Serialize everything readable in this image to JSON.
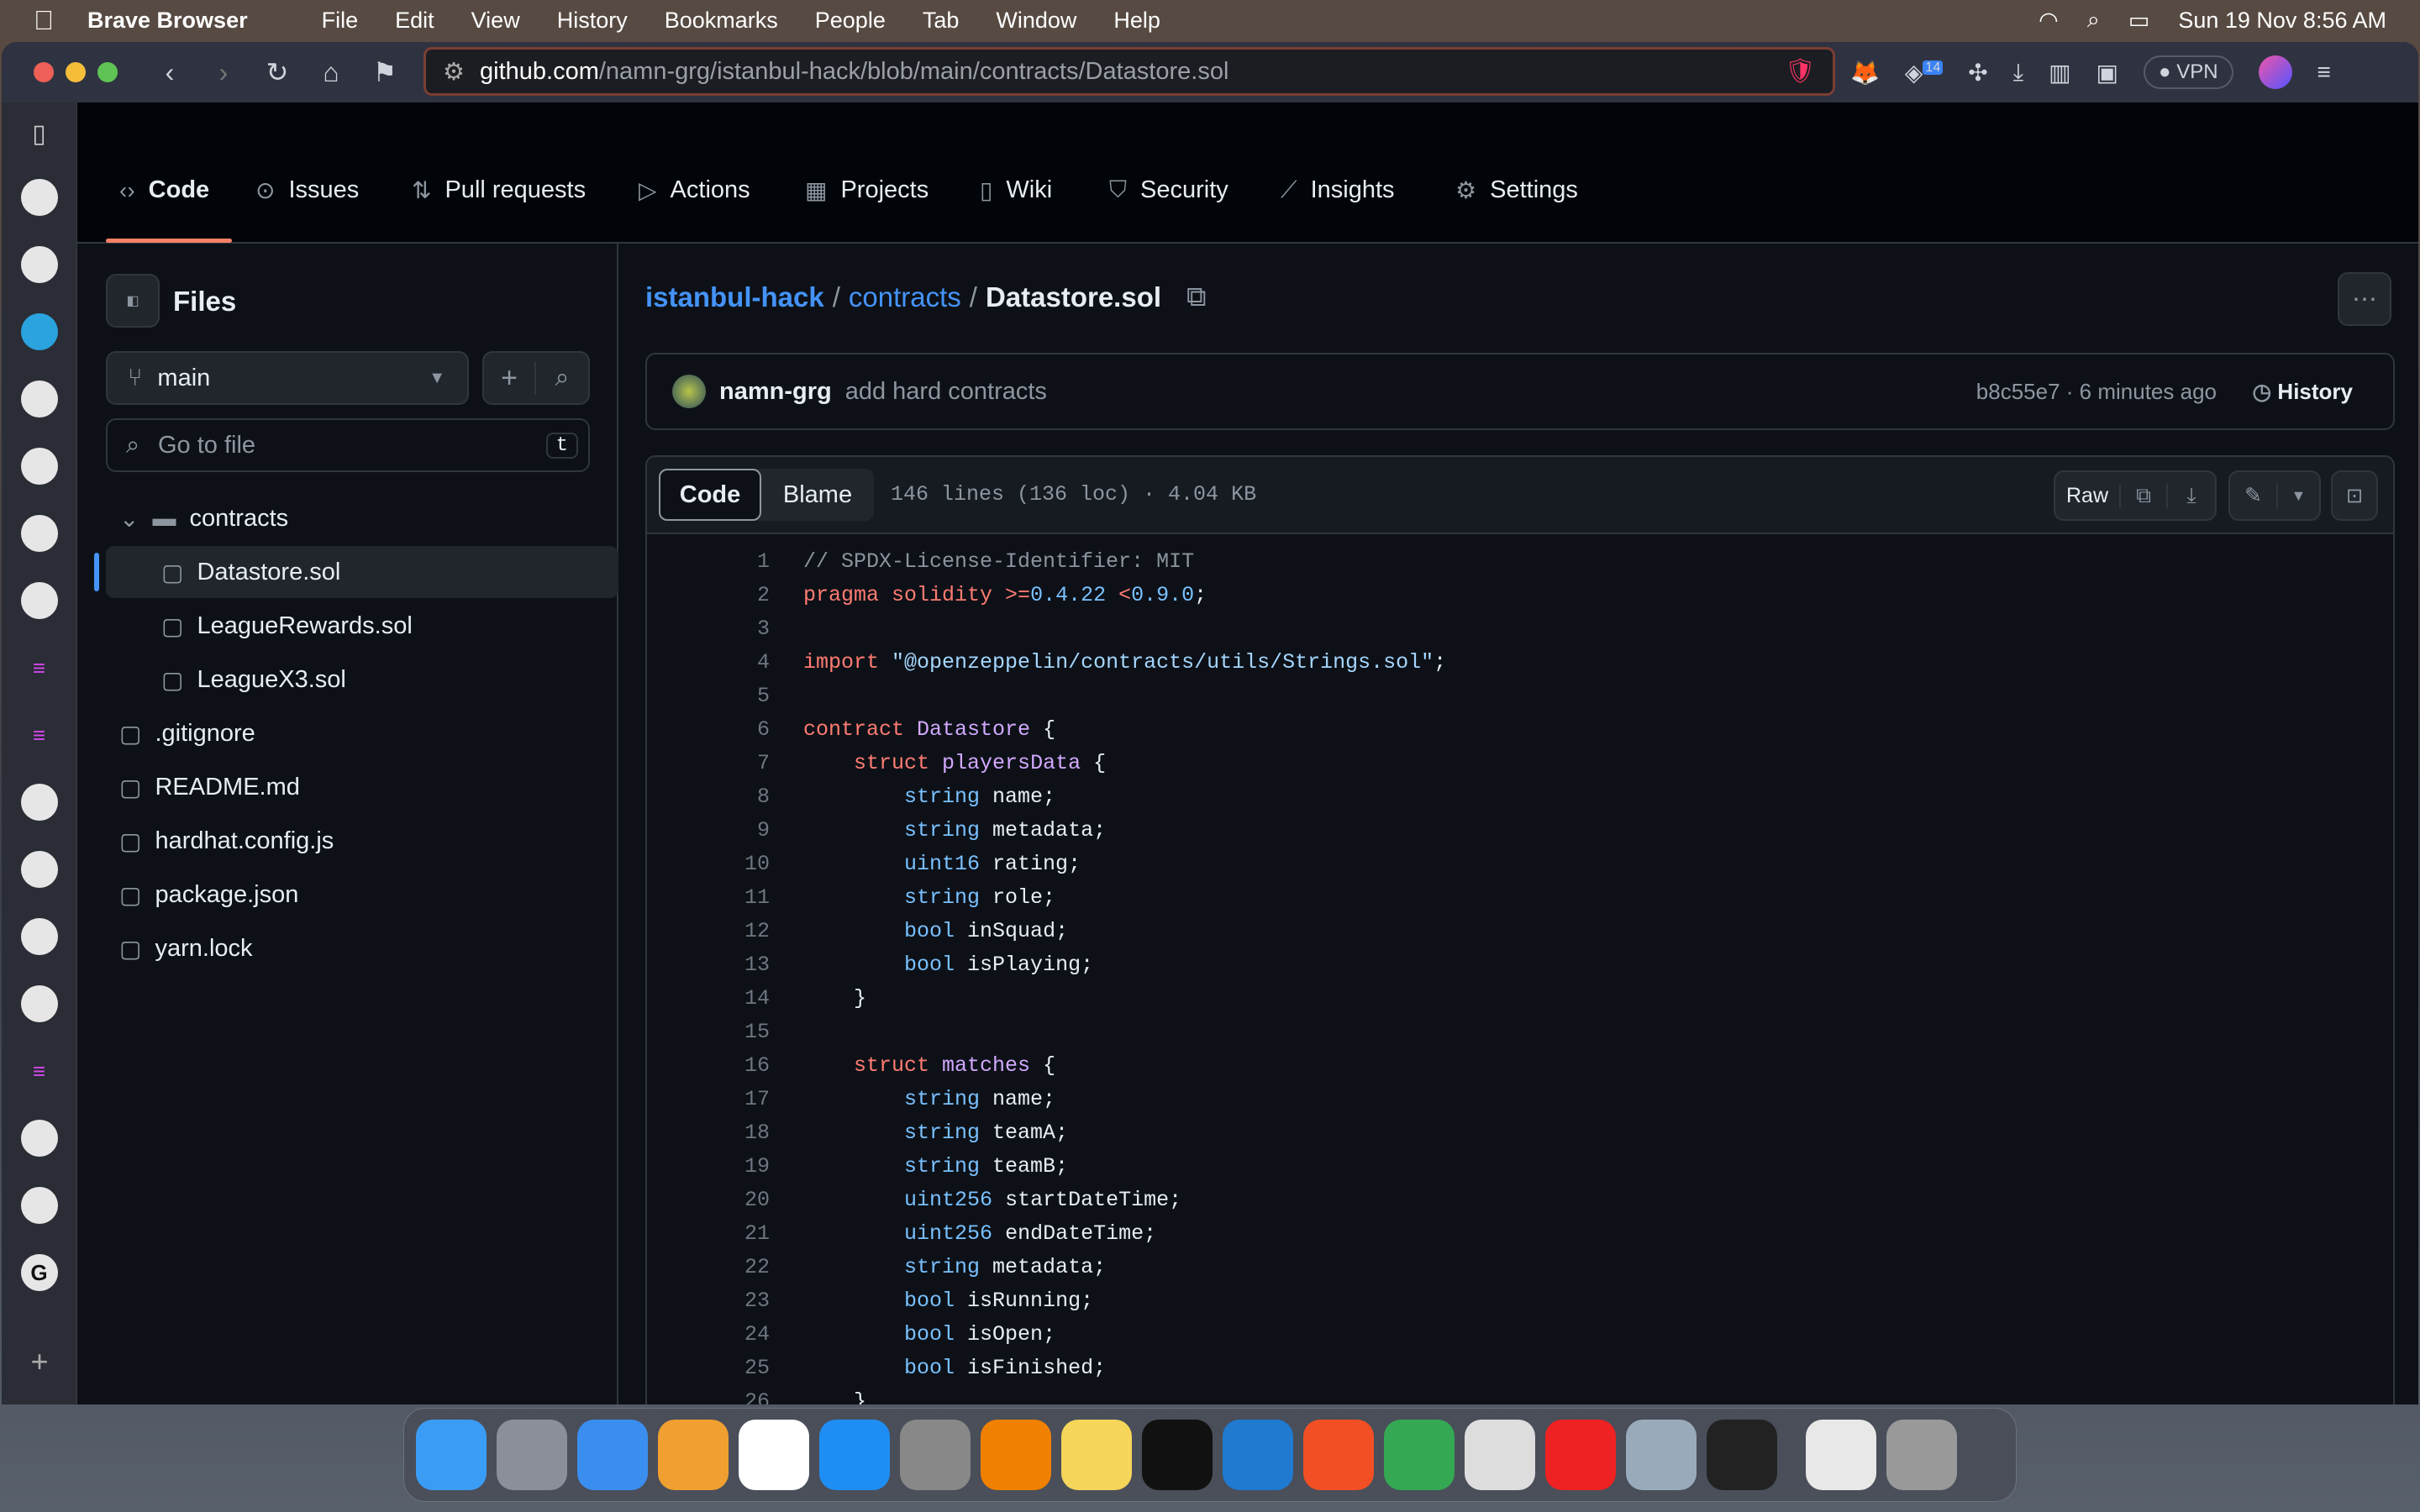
{
  "menubar": {
    "app": "Brave Browser",
    "items": [
      "File",
      "Edit",
      "View",
      "History",
      "Bookmarks",
      "People",
      "Tab",
      "Window",
      "Help"
    ],
    "clock": "Sun 19 Nov  8:56 AM"
  },
  "browser": {
    "url_host": "github.com",
    "url_path": "/namn-grg/istanbul-hack/blob/main/contracts/Datastore.sol",
    "vpn_label": "VPN",
    "ext_badge": "14"
  },
  "repo_nav": {
    "tabs": [
      {
        "label": "Code",
        "icon": "code-icon"
      },
      {
        "label": "Issues",
        "icon": "issue-icon"
      },
      {
        "label": "Pull requests",
        "icon": "pull-request-icon"
      },
      {
        "label": "Actions",
        "icon": "play-icon"
      },
      {
        "label": "Projects",
        "icon": "table-icon"
      },
      {
        "label": "Wiki",
        "icon": "book-icon"
      },
      {
        "label": "Security",
        "icon": "shield-icon"
      },
      {
        "label": "Insights",
        "icon": "graph-icon"
      },
      {
        "label": "Settings",
        "icon": "gear-icon"
      }
    ],
    "active": "Code"
  },
  "files": {
    "title": "Files",
    "branch": "main",
    "search_placeholder": "Go to file",
    "search_shortcut": "t",
    "tree": [
      {
        "name": "contracts",
        "type": "folder",
        "depth": 0,
        "open": true
      },
      {
        "name": "Datastore.sol",
        "type": "file",
        "depth": 1,
        "selected": true
      },
      {
        "name": "LeagueRewards.sol",
        "type": "file",
        "depth": 1
      },
      {
        "name": "LeagueX3.sol",
        "type": "file",
        "depth": 1
      },
      {
        "name": ".gitignore",
        "type": "file",
        "depth": 0
      },
      {
        "name": "README.md",
        "type": "file",
        "depth": 0
      },
      {
        "name": "hardhat.config.js",
        "type": "file",
        "depth": 0
      },
      {
        "name": "package.json",
        "type": "file",
        "depth": 0
      },
      {
        "name": "yarn.lock",
        "type": "file",
        "depth": 0
      }
    ]
  },
  "breadcrumb": {
    "repo": "istanbul-hack",
    "dir": "contracts",
    "file": "Datastore.sol"
  },
  "commit": {
    "author": "namn-grg",
    "message": "add hard contracts",
    "sha": "b8c55e7",
    "time": "6 minutes ago",
    "history_label": "History"
  },
  "viewer": {
    "tab_code": "Code",
    "tab_blame": "Blame",
    "info": "146 lines (136 loc) · 4.04 KB",
    "raw_label": "Raw"
  },
  "colors": {
    "keyword": "#ff7b72",
    "type": "#79c0ff",
    "name": "#d2a8ff",
    "string": "#a5d6ff",
    "accent": "#f78166"
  },
  "code": [
    [
      [
        "c",
        "// SPDX-License-Identifier: MIT"
      ]
    ],
    [
      [
        "k",
        "pragma solidity "
      ],
      [
        "k",
        ">="
      ],
      [
        "t",
        "0.4.22"
      ],
      [
        "p",
        " "
      ],
      [
        "k",
        "<"
      ],
      [
        "t",
        "0.9.0"
      ],
      [
        "p",
        ";"
      ]
    ],
    [],
    [
      [
        "k",
        "import "
      ],
      [
        "s",
        "\"@openzeppelin/contracts/utils/Strings.sol\""
      ],
      [
        "p",
        ";"
      ]
    ],
    [],
    [
      [
        "k",
        "contract "
      ],
      [
        "n",
        "Datastore"
      ],
      [
        "p",
        " {"
      ]
    ],
    [
      [
        "p",
        "    "
      ],
      [
        "k",
        "struct "
      ],
      [
        "n",
        "playersData"
      ],
      [
        "p",
        " {"
      ]
    ],
    [
      [
        "p",
        "        "
      ],
      [
        "t",
        "string"
      ],
      [
        "p",
        " name;"
      ]
    ],
    [
      [
        "p",
        "        "
      ],
      [
        "t",
        "string"
      ],
      [
        "p",
        " metadata;"
      ]
    ],
    [
      [
        "p",
        "        "
      ],
      [
        "t",
        "uint16"
      ],
      [
        "p",
        " rating;"
      ]
    ],
    [
      [
        "p",
        "        "
      ],
      [
        "t",
        "string"
      ],
      [
        "p",
        " role;"
      ]
    ],
    [
      [
        "p",
        "        "
      ],
      [
        "t",
        "bool"
      ],
      [
        "p",
        " inSquad;"
      ]
    ],
    [
      [
        "p",
        "        "
      ],
      [
        "t",
        "bool"
      ],
      [
        "p",
        " isPlaying;"
      ]
    ],
    [
      [
        "p",
        "    }"
      ]
    ],
    [],
    [
      [
        "p",
        "    "
      ],
      [
        "k",
        "struct "
      ],
      [
        "n",
        "matches"
      ],
      [
        "p",
        " {"
      ]
    ],
    [
      [
        "p",
        "        "
      ],
      [
        "t",
        "string"
      ],
      [
        "p",
        " name;"
      ]
    ],
    [
      [
        "p",
        "        "
      ],
      [
        "t",
        "string"
      ],
      [
        "p",
        " teamA;"
      ]
    ],
    [
      [
        "p",
        "        "
      ],
      [
        "t",
        "string"
      ],
      [
        "p",
        " teamB;"
      ]
    ],
    [
      [
        "p",
        "        "
      ],
      [
        "t",
        "uint256"
      ],
      [
        "p",
        " startDateTime;"
      ]
    ],
    [
      [
        "p",
        "        "
      ],
      [
        "t",
        "uint256"
      ],
      [
        "p",
        " endDateTime;"
      ]
    ],
    [
      [
        "p",
        "        "
      ],
      [
        "t",
        "string"
      ],
      [
        "p",
        " metadata;"
      ]
    ],
    [
      [
        "p",
        "        "
      ],
      [
        "t",
        "bool"
      ],
      [
        "p",
        " isRunning;"
      ]
    ],
    [
      [
        "p",
        "        "
      ],
      [
        "t",
        "bool"
      ],
      [
        "p",
        " isOpen;"
      ]
    ],
    [
      [
        "p",
        "        "
      ],
      [
        "t",
        "bool"
      ],
      [
        "p",
        " isFinished;"
      ]
    ],
    [
      [
        "p",
        "    }"
      ]
    ],
    []
  ]
}
